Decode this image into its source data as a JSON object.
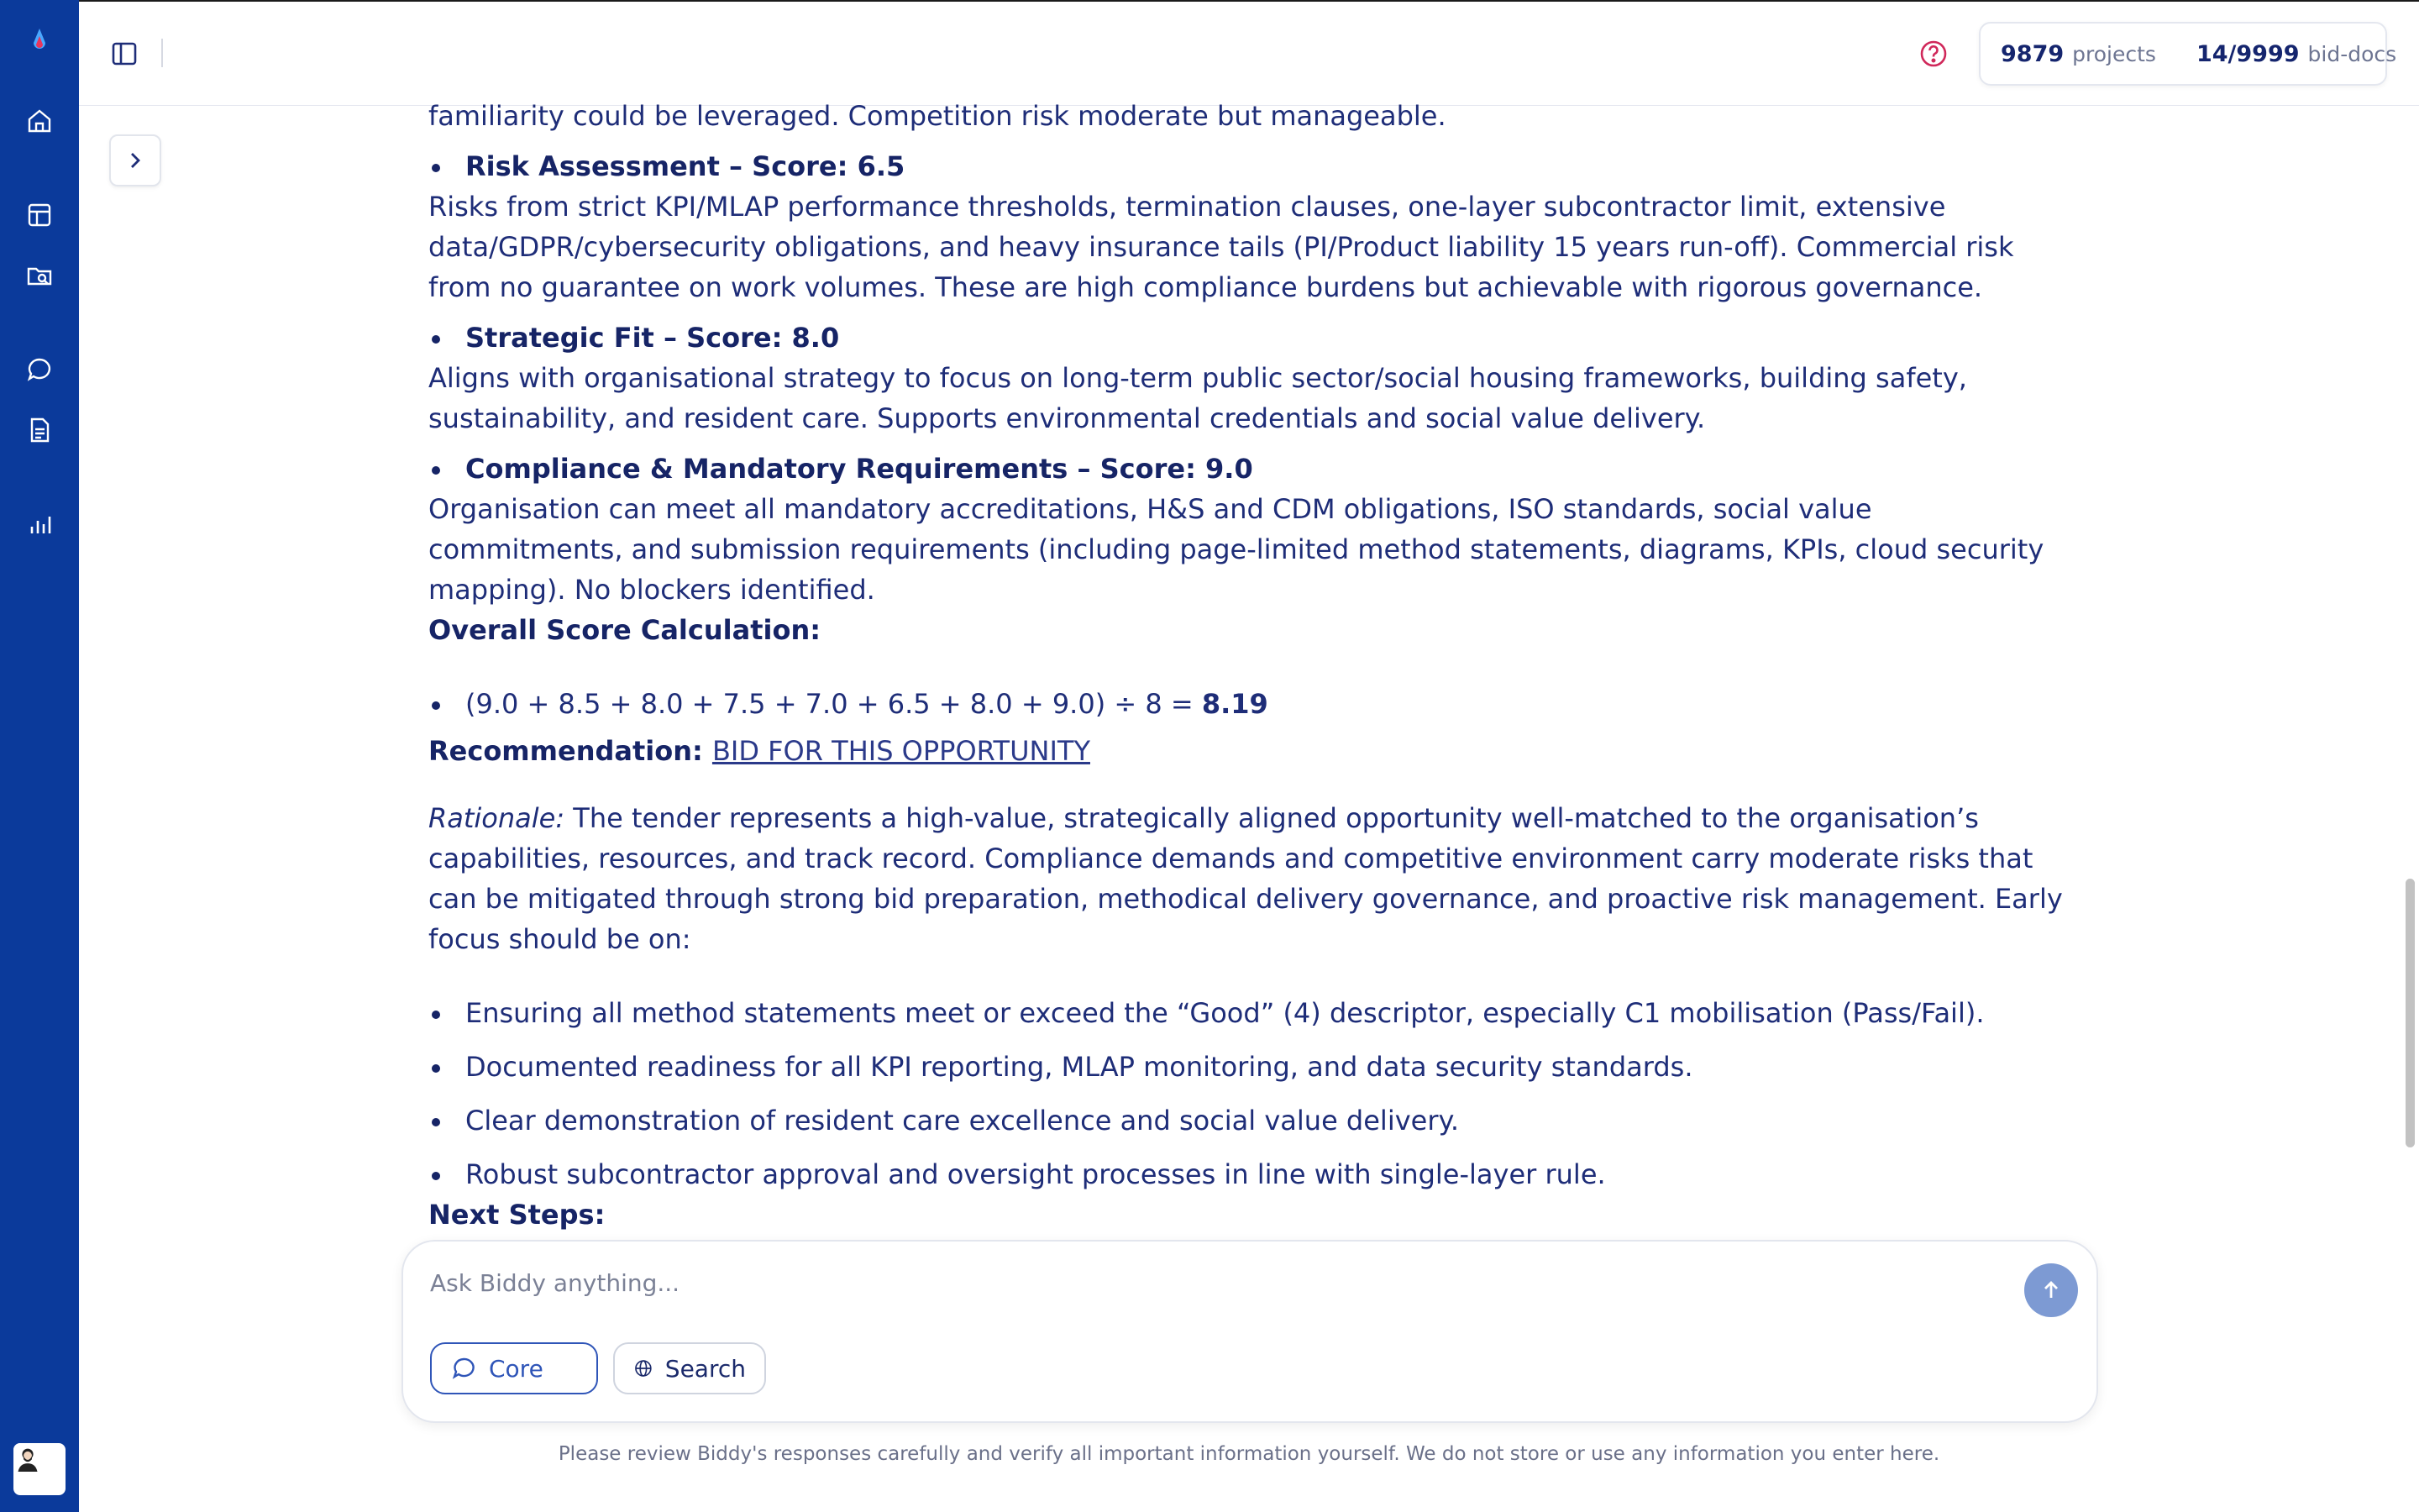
{
  "topbar": {
    "stats": [
      {
        "value": "9879",
        "label": "projects"
      },
      {
        "value": "14/9999",
        "label": "bid-docs"
      }
    ]
  },
  "content": {
    "fragment": "familiarity could be leveraged. Competition risk moderate but manageable.",
    "sections": [
      {
        "title": "Risk Assessment – Score: 6.5",
        "body": "Risks from strict KPI/MLAP performance thresholds, termination clauses, one-layer subcontractor limit, extensive data/GDPR/cybersecurity obligations, and heavy insurance tails (PI/Product liability 15 years run-off). Commercial risk from no guarantee on work volumes. These are high compliance burdens but achievable with rigorous governance."
      },
      {
        "title": "Strategic Fit – Score: 8.0",
        "body": "Aligns with organisational strategy to focus on long-term public sector/social housing frameworks, building safety, sustainability, and resident care. Supports environmental credentials and social value delivery."
      },
      {
        "title": "Compliance & Mandatory Requirements – Score: 9.0",
        "body": "Organisation can meet all mandatory accreditations, H&S and CDM obligations, ISO standards, social value commitments, and submission requirements (including page-limited method statements, diagrams, KPIs, cloud security mapping). No blockers identified."
      }
    ],
    "overall_heading": "Overall Score Calculation:",
    "calculation": "(9.0 + 8.5 + 8.0 + 7.5 + 7.0 + 6.5 + 8.0 + 9.0) ÷ 8 = ",
    "calculation_result": "8.19",
    "recommendation_label": "Recommendation:",
    "recommendation_value": "BID FOR THIS OPPORTUNITY",
    "rationale_label": "Rationale:",
    "rationale_text": " The tender represents a high-value, strategically aligned opportunity well-matched to the organisation’s capabilities, resources, and track record. Compliance demands and competitive environment carry moderate risks that can be mitigated through strong bid preparation, methodical delivery governance, and proactive risk management. Early focus should be on:",
    "focus_items": [
      "Ensuring all method statements meet or exceed the “Good” (4) descriptor, especially C1 mobilisation (Pass/Fail).",
      "Documented readiness for all KPI reporting, MLAP monitoring, and data security standards.",
      "Clear demonstration of resident care excellence and social value delivery.",
      "Robust subcontractor approval and oversight processes in line with single-layer rule."
    ],
    "next_steps_heading": "Next Steps:"
  },
  "composer": {
    "placeholder": "Ask Biddy anything...",
    "chips": {
      "core": "Core",
      "search": "Search"
    }
  },
  "disclaimer": "Please review Biddy's responses carefully and verify all important information yourself. We do not store or use any information you enter here.",
  "colors": {
    "rail": "#0b3a9b",
    "text": "#1e2d78",
    "accent": "#2f55b8",
    "send": "#7d9ad3",
    "help": "#d0285a"
  }
}
